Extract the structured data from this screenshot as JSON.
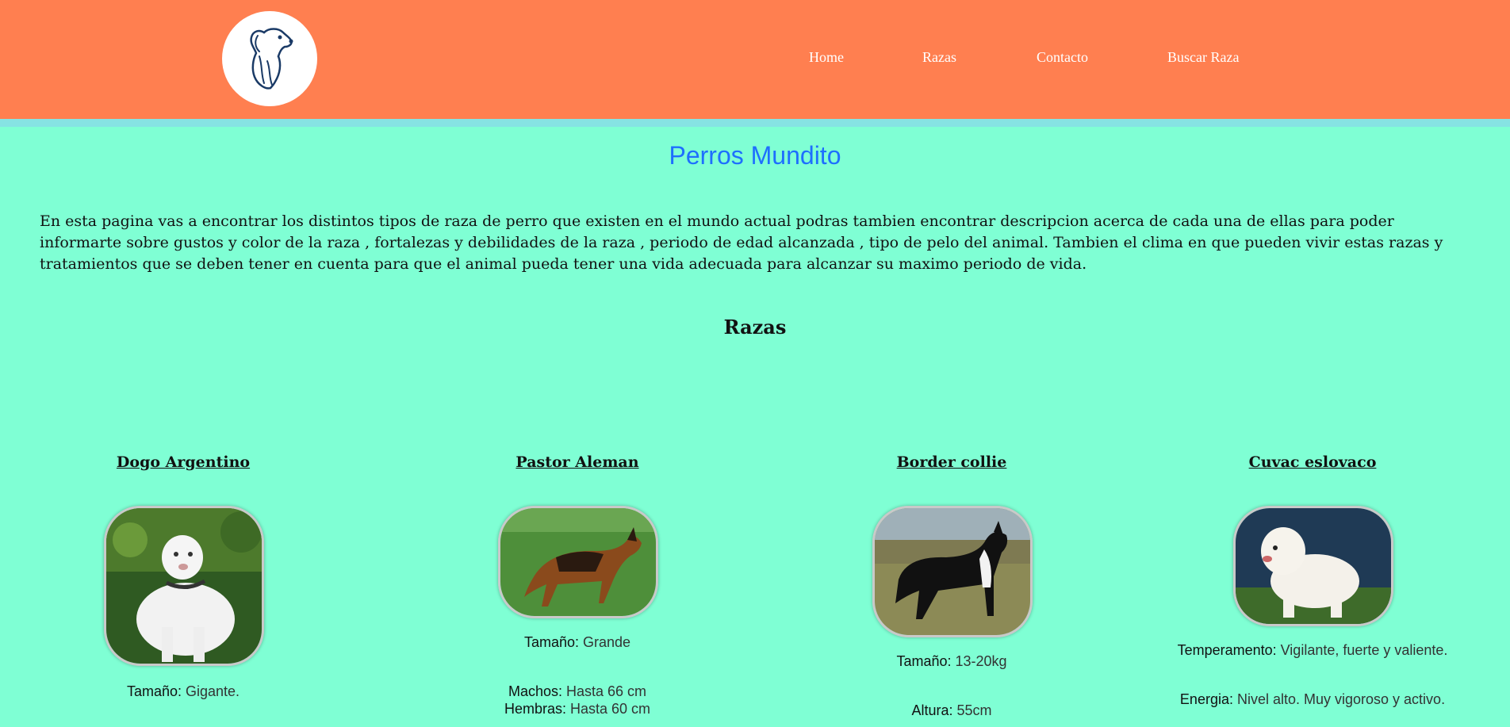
{
  "header": {
    "logo_icon": "dog-head-icon",
    "nav": [
      {
        "label": "Home"
      },
      {
        "label": "Razas"
      },
      {
        "label": "Contacto"
      },
      {
        "label": "Buscar Raza"
      }
    ]
  },
  "colors": {
    "header": "#ff7f50",
    "background": "#7fffd4",
    "title": "#1e6fff"
  },
  "title": "Perros Mundito",
  "intro": "En esta pagina vas a encontrar los distintos tipos de raza de perro que existen en el mundo actual podras tambien encontrar descripcion acerca de cada una de ellas para poder informarte sobre gustos y color de la raza , fortalezas y debilidades de la raza , periodo de edad alcanzada , tipo de pelo del animal. Tambien el clima en que pueden vivir estas razas y tratamientos que se deben tener en cuenta para que el animal pueda tener una vida adecuada para alcanzar su maximo periodo de vida.",
  "section_title": "Razas",
  "breeds": [
    {
      "name": "Dogo Argentino",
      "image": "white-dogo-argentino-photo",
      "info": [
        {
          "label": "Tamaño:",
          "value": " Gigante."
        }
      ]
    },
    {
      "name": "Pastor Aleman",
      "image": "german-shepherd-photo",
      "info": [
        {
          "label": "Tamaño:",
          "value": " Grande"
        },
        {
          "label": "Machos:",
          "value": " Hasta 66 cm"
        },
        {
          "label": "Hembras:",
          "value": " Hasta 60 cm"
        }
      ]
    },
    {
      "name": "Border collie",
      "image": "border-collie-photo",
      "info": [
        {
          "label": "Tamaño:",
          "value": " 13-20kg"
        },
        {
          "label": "Altura:",
          "value": " 55cm"
        }
      ]
    },
    {
      "name": "Cuvac eslovaco",
      "image": "slovak-cuvac-photo",
      "info": [
        {
          "label": "Temperamento:",
          "value": " Vigilante, fuerte y valiente."
        },
        {
          "label": "Energia:",
          "value": " Nivel alto. Muy vigoroso y activo."
        }
      ]
    }
  ]
}
